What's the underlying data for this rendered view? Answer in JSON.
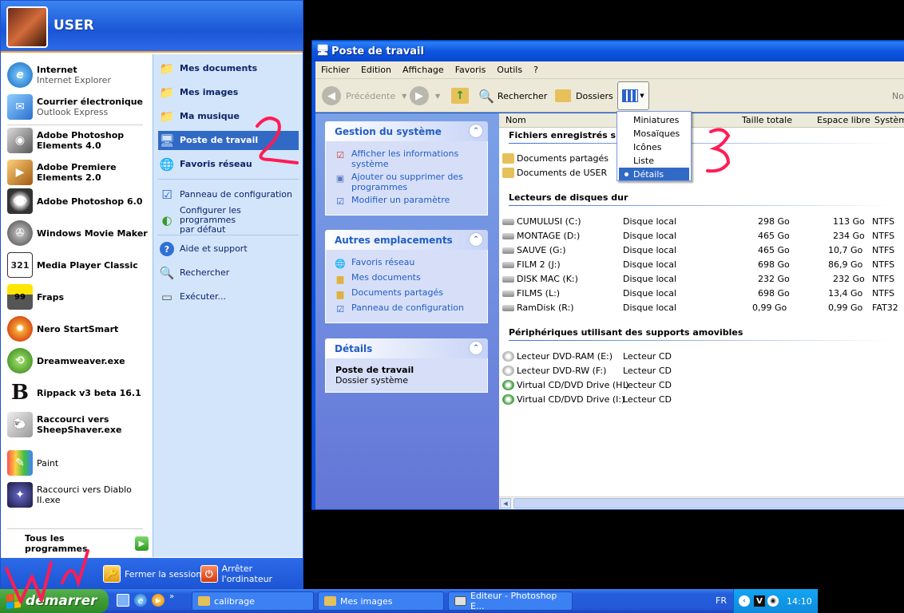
{
  "start_menu": {
    "user_name": "USER",
    "pinned": [
      {
        "title": "Internet",
        "subtitle": "Internet Explorer",
        "icon": "internet-explorer-icon"
      },
      {
        "title": "Courrier électronique",
        "subtitle": "Outlook Express",
        "icon": "outlook-express-icon"
      }
    ],
    "recent": [
      {
        "title": "Adobe Photoshop",
        "title2": "Elements 4.0",
        "icon": "photoshop-elements-icon"
      },
      {
        "title": "Adobe Premiere",
        "title2": "Elements 2.0",
        "icon": "premiere-elements-icon"
      },
      {
        "title": "Adobe Photoshop 6.0",
        "icon": "photoshop-icon"
      },
      {
        "title": "Windows Movie Maker",
        "icon": "movie-maker-icon"
      },
      {
        "title": "Media Player Classic",
        "icon": "media-player-classic-icon"
      },
      {
        "title": "Fraps",
        "icon": "fraps-icon"
      },
      {
        "title": "Nero StartSmart",
        "icon": "nero-icon"
      },
      {
        "title": "Dreamweaver.exe",
        "icon": "dreamweaver-icon"
      },
      {
        "title": "Rippack v3 beta 16.1",
        "icon": "rippack-icon"
      },
      {
        "title": "Raccourci vers",
        "title2": "SheepShaver.exe",
        "icon": "sheepshaver-icon"
      },
      {
        "title": "Paint",
        "icon": "paint-icon"
      },
      {
        "title": "Raccourci vers Diablo II.exe",
        "icon": "diablo-icon"
      }
    ],
    "all_programs": "Tous les programmes",
    "right_items": [
      {
        "label": "Mes documents",
        "icon": "folder-icon"
      },
      {
        "label": "Mes images",
        "icon": "folder-images-icon"
      },
      {
        "label": "Ma musique",
        "icon": "folder-music-icon"
      },
      {
        "label": "Poste de travail",
        "icon": "computer-icon"
      },
      {
        "label": "Favoris réseau",
        "icon": "network-icon"
      },
      {
        "label": "Panneau de configuration",
        "icon": "control-panel-icon"
      },
      {
        "label": "Configurer les programmes",
        "label2": "par défaut",
        "icon": "default-programs-icon"
      },
      {
        "label": "Aide et support",
        "icon": "help-icon"
      },
      {
        "label": "Rechercher",
        "icon": "search-icon"
      },
      {
        "label": "Exécuter...",
        "icon": "run-icon"
      }
    ],
    "logoff": "Fermer la session",
    "shutdown": "Arrêter l'ordinateur"
  },
  "taskbar": {
    "start_label": "démarrer",
    "buttons": [
      "calibrage",
      "Mes images",
      "Editeur - Photoshop E..."
    ],
    "lang": "FR",
    "clock": "14:10"
  },
  "explorer": {
    "title": "Poste de travail",
    "menu": [
      "Fichier",
      "Edition",
      "Affichage",
      "Favoris",
      "Outils",
      "?"
    ],
    "toolbar": {
      "back": "Précédente",
      "search": "Rechercher",
      "folders": "Dossiers"
    },
    "tasks": {
      "system": {
        "title": "Gestion du système",
        "items": [
          "Afficher les informations système",
          "Ajouter ou supprimer des programmes",
          "Modifier un paramètre"
        ]
      },
      "other": {
        "title": "Autres emplacements",
        "items": [
          "Favoris réseau",
          "Mes documents",
          "Documents partagés",
          "Panneau de configuration"
        ]
      },
      "details": {
        "title": "Détails",
        "name": "Poste de travail",
        "type": "Dossier système"
      }
    },
    "columns": {
      "name": "Nom",
      "total": "Taille totale",
      "free": "Espace libre",
      "fs": "Système",
      "cut": "Nor"
    },
    "groups": {
      "files": "Fichiers enregistrés sur",
      "hdd": "Lecteurs de disques dur",
      "removable": "Périphériques utilisant des supports amovibles"
    },
    "files": [
      "Documents partagés",
      "Documents de USER"
    ],
    "drives": [
      {
        "name": "CUMULUSI (C:)",
        "type": "Disque local",
        "total": "298 Go",
        "free": "113 Go",
        "fs": "NTFS"
      },
      {
        "name": "MONTAGE (D:)",
        "type": "Disque local",
        "total": "465 Go",
        "free": "234 Go",
        "fs": "NTFS"
      },
      {
        "name": "SAUVE (G:)",
        "type": "Disque local",
        "total": "465 Go",
        "free": "10,7 Go",
        "fs": "NTFS"
      },
      {
        "name": "FILM 2 (J:)",
        "type": "Disque local",
        "total": "698 Go",
        "free": "86,9 Go",
        "fs": "NTFS"
      },
      {
        "name": "DISK MAC (K:)",
        "type": "Disque local",
        "total": "232 Go",
        "free": "232 Go",
        "fs": "NTFS"
      },
      {
        "name": "FILMS (L:)",
        "type": "Disque local",
        "total": "698 Go",
        "free": "13,4 Go",
        "fs": "NTFS"
      },
      {
        "name": "RamDisk (R:)",
        "type": "Disque local",
        "total": "0,99 Go",
        "free": "0,99 Go",
        "fs": "FAT32"
      }
    ],
    "removable": [
      {
        "name": "Lecteur DVD-RAM (E:)",
        "type": "Lecteur CD"
      },
      {
        "name": "Lecteur DVD-RW (F:)",
        "type": "Lecteur CD"
      },
      {
        "name": "Virtual CD/DVD Drive (H:)",
        "type": "Lecteur CD"
      },
      {
        "name": "Virtual CD/DVD Drive (I:)",
        "type": "Lecteur CD"
      }
    ],
    "view_menu": [
      "Miniatures",
      "Mosaïques",
      "Icônes",
      "Liste",
      "Détails"
    ]
  },
  "annotations": [
    "2",
    "3"
  ],
  "colors": {
    "xp_blue": "#245edb",
    "start_green": "#3d9c35",
    "selection": "#316ac5",
    "annotation": "#ff1c55"
  }
}
